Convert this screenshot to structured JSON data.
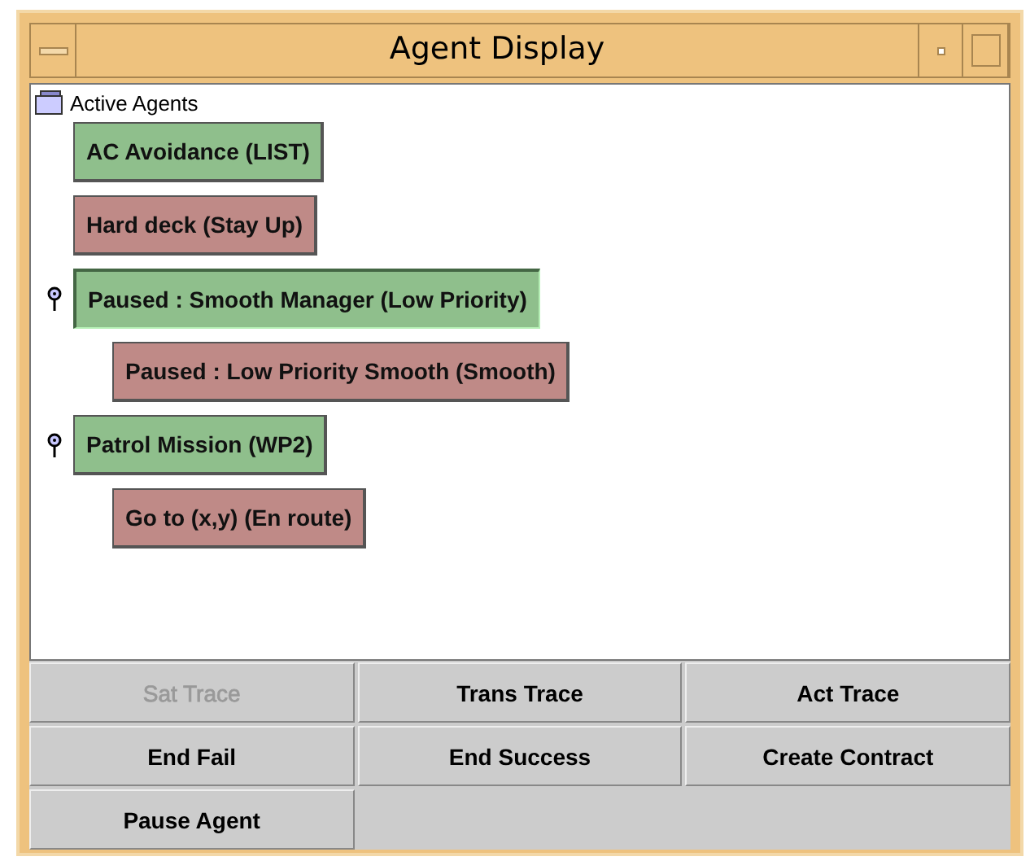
{
  "window": {
    "title": "Agent Display"
  },
  "tree": {
    "root": "Active Agents",
    "items": [
      {
        "label": "AC Avoidance (LIST)",
        "color": "#8fbf8c",
        "selected": false
      },
      {
        "label": "Hard deck (Stay Up)",
        "color": "#bf8a87",
        "selected": false
      },
      {
        "label": "Paused : Smooth Manager (Low Priority)",
        "color": "#8fbf8c",
        "selected": true,
        "children": [
          {
            "label": "Paused : Low Priority Smooth (Smooth)",
            "color": "#bf8a87",
            "selected": false
          }
        ]
      },
      {
        "label": "Patrol Mission (WP2)",
        "color": "#8fbf8c",
        "selected": false,
        "children": [
          {
            "label": "Go to (x,y) (En route)",
            "color": "#bf8a87",
            "selected": false
          }
        ]
      }
    ]
  },
  "buttons": [
    {
      "label": "Sat Trace",
      "disabled": true
    },
    {
      "label": "Trans Trace",
      "disabled": false
    },
    {
      "label": "Act Trace",
      "disabled": false
    },
    {
      "label": "End Fail",
      "disabled": false
    },
    {
      "label": "End Success",
      "disabled": false
    },
    {
      "label": "Create Contract",
      "disabled": false
    },
    {
      "label": "Pause Agent",
      "disabled": false
    }
  ]
}
